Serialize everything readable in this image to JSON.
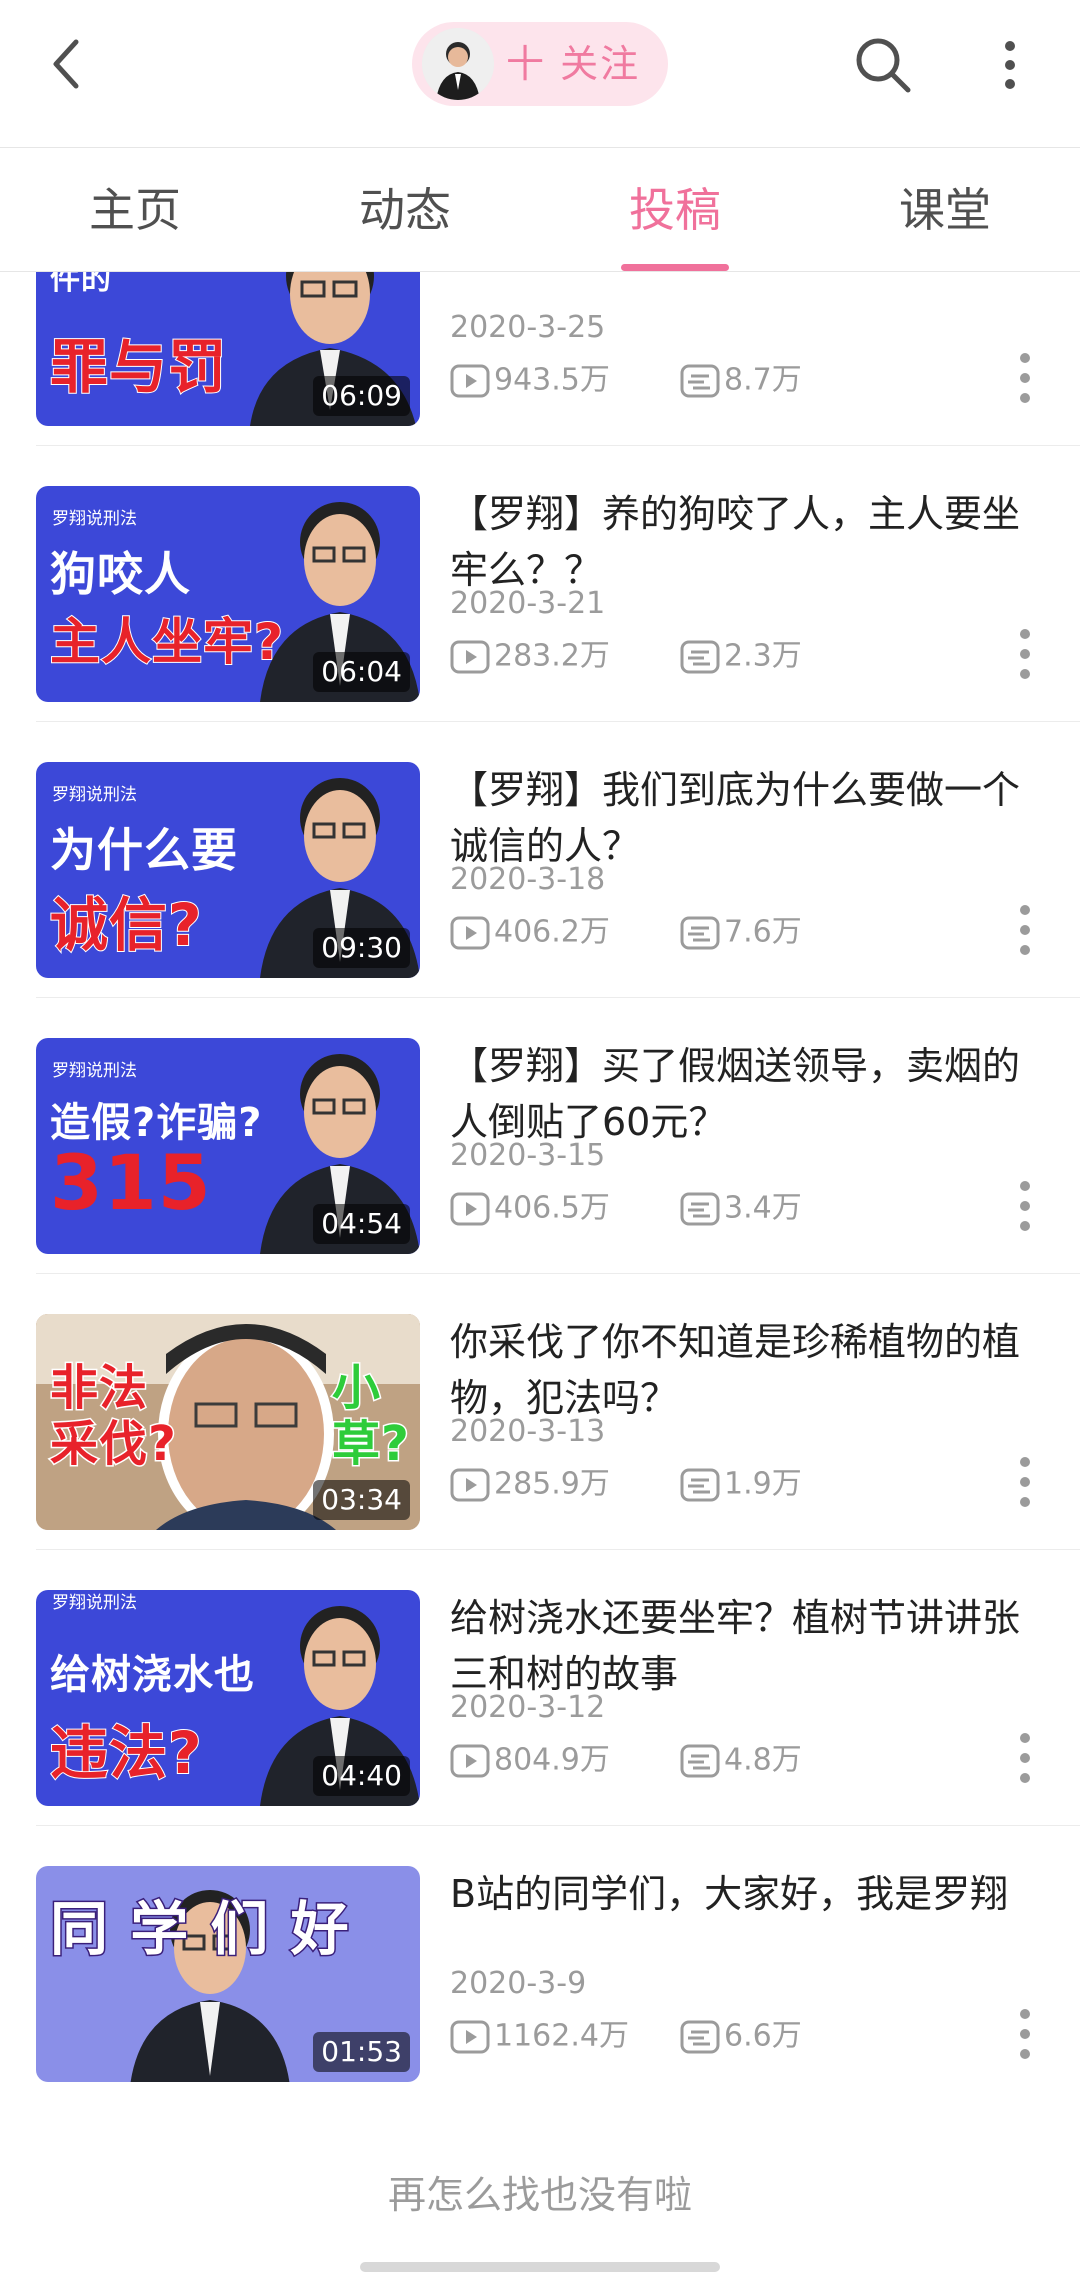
{
  "header": {
    "follow_label": "十 关注",
    "icons": {
      "back": "back-arrow-icon",
      "search": "search-icon",
      "more": "more-vertical-icon"
    }
  },
  "tabs": [
    {
      "label": "主页"
    },
    {
      "label": "动态"
    },
    {
      "label": "投稿"
    },
    {
      "label": "课堂"
    }
  ],
  "active_tab": "投稿",
  "accent_color": "#f0719b",
  "videos": [
    {
      "thumb_tag": "",
      "thumb_line1": "韩国N号房 事件的",
      "thumb_line2": "罪与罚",
      "duration": "06:09",
      "title": "",
      "date": "2020-3-25",
      "plays": "943.5万",
      "danmaku": "8.7万"
    },
    {
      "thumb_tag": "罗翔说刑法",
      "thumb_line1": "狗咬人",
      "thumb_line2": "主人坐牢?",
      "duration": "06:04",
      "title": "【罗翔】养的狗咬了人，主人要坐牢么？？",
      "date": "2020-3-21",
      "plays": "283.2万",
      "danmaku": "2.3万"
    },
    {
      "thumb_tag": "罗翔说刑法",
      "thumb_line1": "为什么要",
      "thumb_line2": "诚信?",
      "duration": "09:30",
      "title": "【罗翔】我们到底为什么要做一个诚信的人？",
      "date": "2020-3-18",
      "plays": "406.2万",
      "danmaku": "7.6万"
    },
    {
      "thumb_tag": "罗翔说刑法",
      "thumb_line1": "造假?诈骗?",
      "thumb_line2": "315",
      "duration": "04:54",
      "title": "【罗翔】买了假烟送领导，卖烟的人倒贴了60元？",
      "date": "2020-3-15",
      "plays": "406.5万",
      "danmaku": "3.4万"
    },
    {
      "thumb_tag": "",
      "thumb_line1": "非法 采伐?",
      "thumb_line2": "小 草?",
      "duration": "03:34",
      "title": "你采伐了你不知道是珍稀植物的植物，犯法吗？",
      "date": "2020-3-13",
      "plays": "285.9万",
      "danmaku": "1.9万"
    },
    {
      "thumb_tag": "罗翔说刑法",
      "thumb_line1": "给树浇水也",
      "thumb_line2": "违法?",
      "duration": "04:40",
      "title": "给树浇水还要坐牢？植树节讲讲张三和树的故事",
      "date": "2020-3-12",
      "plays": "804.9万",
      "danmaku": "4.8万"
    },
    {
      "thumb_tag": "",
      "thumb_line1": "同 学 们 好",
      "thumb_line2": "",
      "duration": "01:53",
      "title": "B站的同学们，大家好，我是罗翔",
      "date": "2020-3-9",
      "plays": "1162.4万",
      "danmaku": "6.6万"
    }
  ],
  "footer": {
    "end_text": "再怎么找也没有啦"
  }
}
